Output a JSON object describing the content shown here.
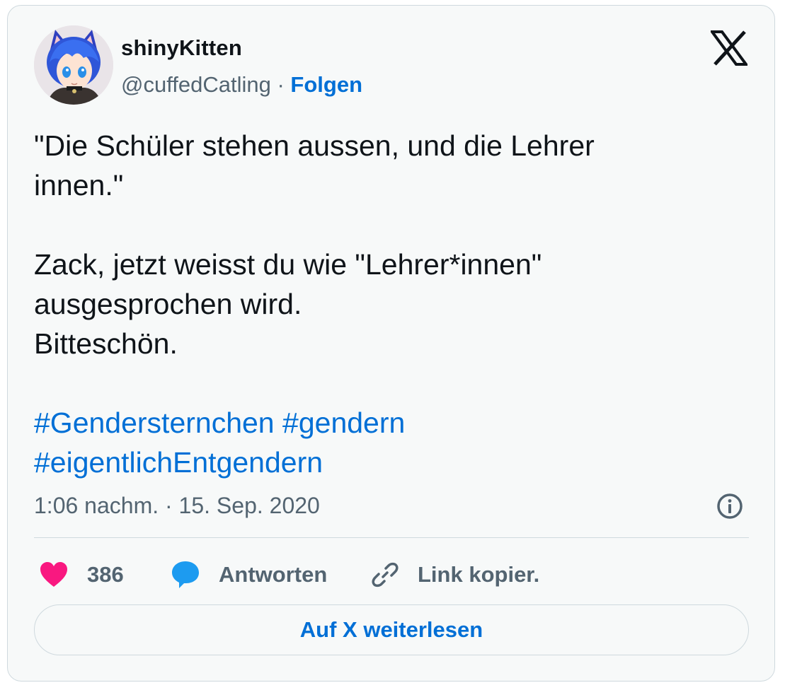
{
  "author": {
    "display_name": "shinyKitten",
    "handle": "@cuffedCatling",
    "separator": " · ",
    "follow_label": "Folgen"
  },
  "tweet": {
    "lines": [
      "\"Die Schüler stehen aussen, und die Lehrer",
      "innen.\"",
      "Zack, jetzt weisst du wie \"Lehrer*innen\"",
      "ausgesprochen wird.",
      "Bitteschön."
    ],
    "hashtags": [
      "#Gendersternchen",
      "#gendern",
      "#eigentlichEntgendern"
    ]
  },
  "timestamp": "1:06 nachm. · 15. Sep. 2020",
  "actions": {
    "likes_count": "386",
    "reply_label": "Antworten",
    "copy_link_label": "Link kopier."
  },
  "read_more_label": "Auf X weiterlesen",
  "icons": {
    "platform": "x-logo-icon",
    "info": "info-icon",
    "like": "heart-icon",
    "reply": "speech-bubble-icon",
    "copy": "link-icon"
  },
  "colors": {
    "link_blue": "#006fd6",
    "heart_pink": "#f91880",
    "reply_blue": "#1d9bf0",
    "muted_text": "#536471",
    "border": "#cfd9de",
    "card_bg": "#f7f9f9"
  }
}
